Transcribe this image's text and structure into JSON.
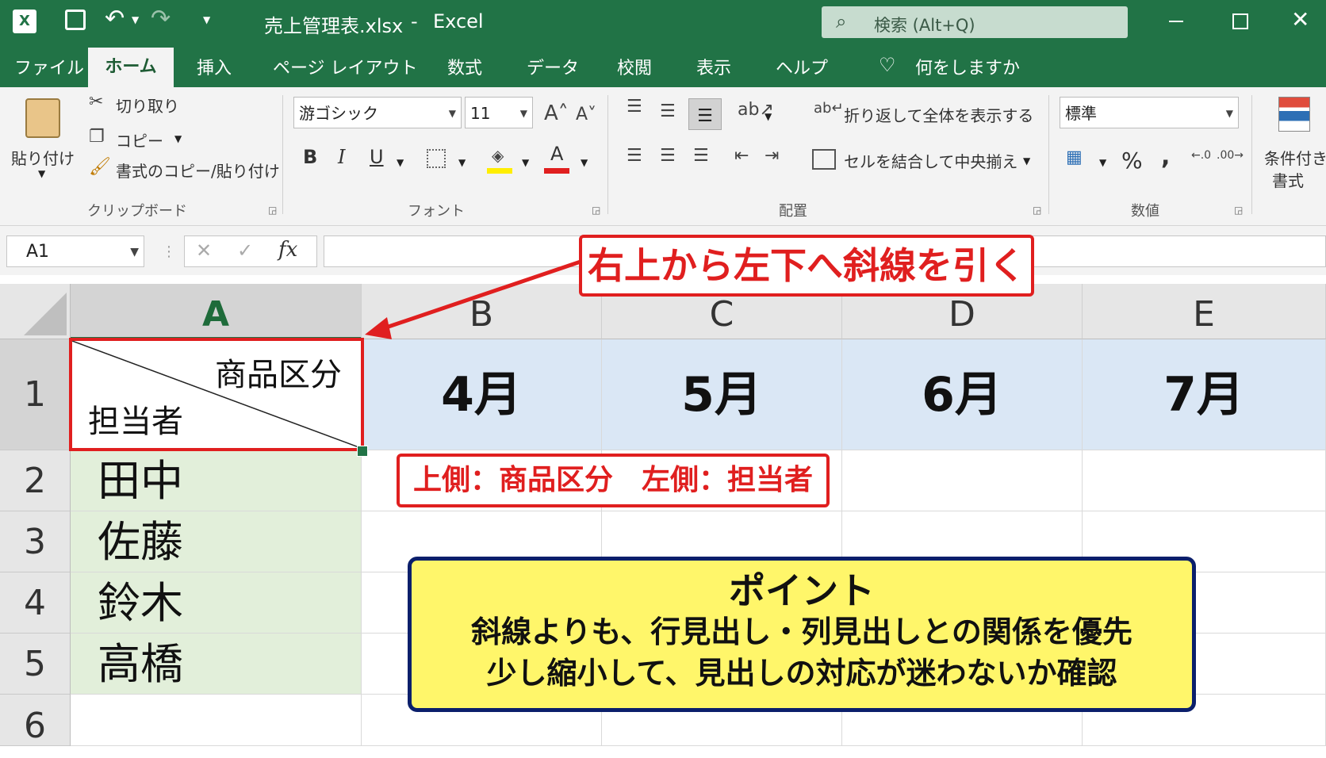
{
  "titlebar": {
    "filename": "売上管理表.xlsx",
    "separator": "-",
    "app": "Excel",
    "search_placeholder": "検索 (Alt+Q)"
  },
  "menu_tabs": [
    "ファイル",
    "ホーム",
    "挿入",
    "ページ レイアウト",
    "数式",
    "データ",
    "校閲",
    "表示",
    "ヘルプ",
    "何をしますか"
  ],
  "ribbon": {
    "clipboard": {
      "paste": "貼り付け",
      "cut": "切り取り",
      "copy": "コピー",
      "format_painter": "書式のコピー/貼り付け",
      "group": "クリップボード"
    },
    "font": {
      "font_name": "游ゴシック",
      "font_size": "11",
      "bold": "B",
      "italic": "I",
      "underline": "U",
      "font_color_letter": "A",
      "group": "フォント"
    },
    "alignment": {
      "wrap_text": "折り返して全体を表示する",
      "merge_center": "セルを結合して中央揃え",
      "group": "配置"
    },
    "number": {
      "format": "標準",
      "percent": "%",
      "comma": ",",
      "group": "数値"
    },
    "styles": {
      "conditional_line1": "条件付き",
      "conditional_line2": "書式"
    }
  },
  "formula_bar": {
    "name_box": "A1",
    "fx": "fx",
    "value": ""
  },
  "grid": {
    "columns": [
      "A",
      "B",
      "C",
      "D",
      "E"
    ],
    "rows": [
      "1",
      "2",
      "3",
      "4",
      "5",
      "6"
    ],
    "a1_top_label": "商品区分",
    "a1_bottom_label": "担当者",
    "months": [
      "4月",
      "5月",
      "6月",
      "7月"
    ],
    "names": [
      "田中",
      "佐藤",
      "鈴木",
      "高橋"
    ]
  },
  "callouts": {
    "diagonal": "右上から左下へ斜線を引く",
    "sides": "上側：商品区分　左側：担当者",
    "point_title": "ポイント",
    "point_line1": "斜線よりも、行見出し・列見出しとの関係を優先",
    "point_line2": "少し縮小して、見出しの対応が迷わないか確認"
  },
  "colors": {
    "excel_green": "#217346",
    "header_blue_fill": "#dae7f5",
    "name_green_fill": "#e2efda",
    "callout_red": "#e01f1f",
    "point_yellow": "#fff66a",
    "point_navy": "#0b1f6b"
  }
}
